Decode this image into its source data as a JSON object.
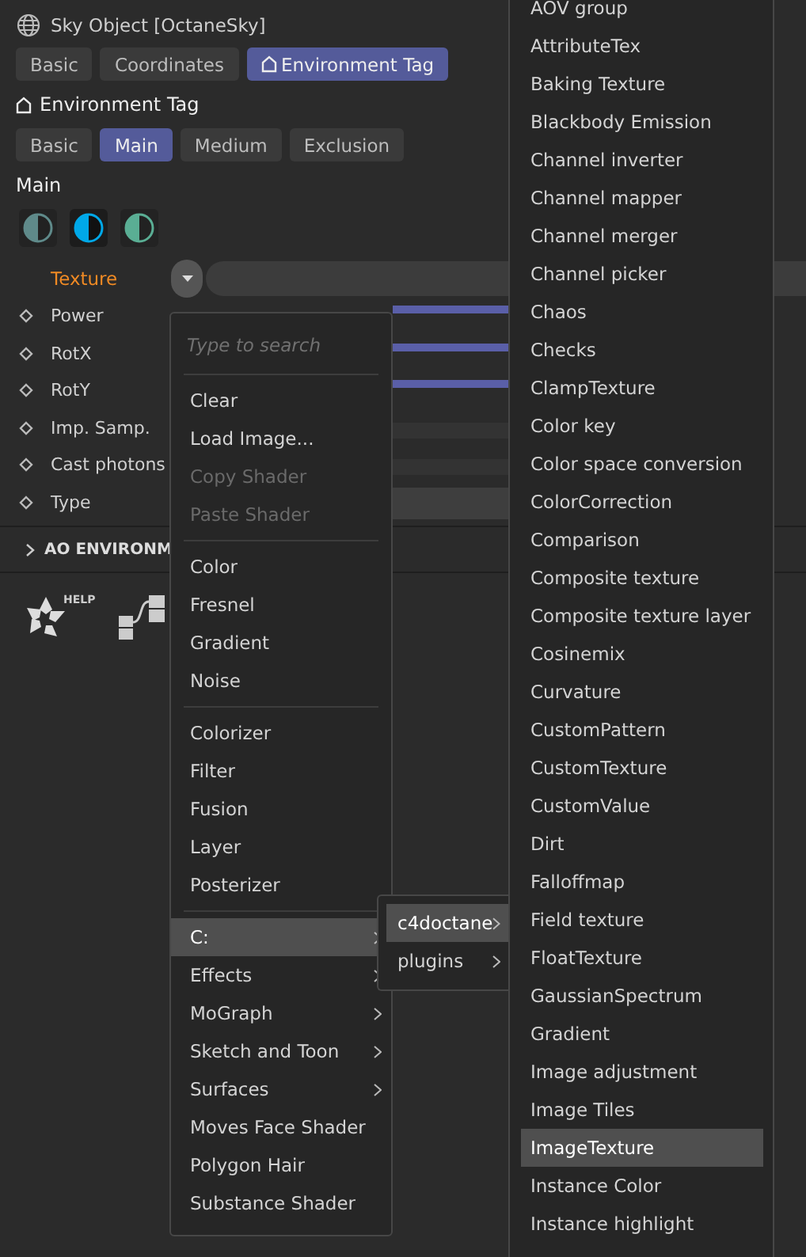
{
  "window": {
    "title": "Sky Object [OctaneSky]"
  },
  "tabs": [
    {
      "label": "Basic",
      "selected": false,
      "kind": "plain"
    },
    {
      "label": "Coordinates",
      "selected": false,
      "kind": "plain"
    },
    {
      "label": "Environment Tag",
      "selected": true,
      "kind": "tag"
    }
  ],
  "section": {
    "title": "Environment Tag"
  },
  "subtabs": [
    {
      "label": "Basic",
      "selected": false
    },
    {
      "label": "Main",
      "selected": true
    },
    {
      "label": "Medium",
      "selected": false
    },
    {
      "label": "Exclusion",
      "selected": false
    }
  ],
  "group_title": "Main",
  "presets": [
    {
      "color": "#5f8a8a",
      "selected": false
    },
    {
      "color": "#00a8e8",
      "selected": true
    },
    {
      "color": "#5aae94",
      "selected": false
    }
  ],
  "texture": {
    "label": "Texture"
  },
  "params": [
    {
      "label": "Power",
      "kind": "slider"
    },
    {
      "label": "RotX",
      "kind": "slider"
    },
    {
      "label": "RotY",
      "kind": "slider"
    },
    {
      "label": "Imp. Samp.",
      "kind": "checkbox"
    },
    {
      "label": "Cast photons",
      "kind": "checkbox"
    },
    {
      "label": "Type",
      "kind": "dropdown"
    }
  ],
  "collapsed_section": {
    "label": "AO ENVIRONM",
    "expanded": false
  },
  "help": {
    "label": "HELP"
  },
  "shader_menu": {
    "placeholder": "Type to search",
    "groups": [
      [
        {
          "label": "Clear",
          "disabled": false
        },
        {
          "label": "Load Image...",
          "disabled": false
        },
        {
          "label": "Copy Shader",
          "disabled": true
        },
        {
          "label": "Paste Shader",
          "disabled": true
        }
      ],
      [
        {
          "label": "Color",
          "disabled": false
        },
        {
          "label": "Fresnel",
          "disabled": false
        },
        {
          "label": "Gradient",
          "disabled": false
        },
        {
          "label": "Noise",
          "disabled": false
        }
      ],
      [
        {
          "label": "Colorizer",
          "disabled": false
        },
        {
          "label": "Filter",
          "disabled": false
        },
        {
          "label": "Fusion",
          "disabled": false
        },
        {
          "label": "Layer",
          "disabled": false
        },
        {
          "label": "Posterizer",
          "disabled": false
        }
      ],
      [
        {
          "label": "C:",
          "disabled": false,
          "submenu": true,
          "selected": true
        },
        {
          "label": "Effects",
          "disabled": false,
          "submenu": true,
          "selected": false
        },
        {
          "label": "MoGraph",
          "disabled": false,
          "submenu": true,
          "selected": false
        },
        {
          "label": "Sketch and Toon",
          "disabled": false,
          "submenu": true,
          "selected": false
        },
        {
          "label": "Surfaces",
          "disabled": false,
          "submenu": true,
          "selected": false
        },
        {
          "label": "Moves Face Shader",
          "disabled": false,
          "submenu": false,
          "selected": false
        },
        {
          "label": "Polygon Hair",
          "disabled": false,
          "submenu": false,
          "selected": false
        },
        {
          "label": "Substance Shader",
          "disabled": false,
          "submenu": false,
          "selected": false
        }
      ]
    ]
  },
  "path_menu": [
    {
      "label": "c4doctane",
      "selected": true
    },
    {
      "label": "plugins",
      "selected": false
    }
  ],
  "octane_menu": [
    {
      "label": "AOV group",
      "selected": false
    },
    {
      "label": "AttributeTex",
      "selected": false
    },
    {
      "label": "Baking Texture",
      "selected": false
    },
    {
      "label": "Blackbody Emission",
      "selected": false
    },
    {
      "label": "Channel inverter",
      "selected": false
    },
    {
      "label": "Channel mapper",
      "selected": false
    },
    {
      "label": "Channel merger",
      "selected": false
    },
    {
      "label": "Channel picker",
      "selected": false
    },
    {
      "label": "Chaos",
      "selected": false
    },
    {
      "label": "Checks",
      "selected": false
    },
    {
      "label": "ClampTexture",
      "selected": false
    },
    {
      "label": "Color key",
      "selected": false
    },
    {
      "label": "Color space conversion",
      "selected": false
    },
    {
      "label": "ColorCorrection",
      "selected": false
    },
    {
      "label": "Comparison",
      "selected": false
    },
    {
      "label": "Composite texture",
      "selected": false
    },
    {
      "label": "Composite texture layer",
      "selected": false
    },
    {
      "label": "Cosinemix",
      "selected": false
    },
    {
      "label": "Curvature",
      "selected": false
    },
    {
      "label": "CustomPattern",
      "selected": false
    },
    {
      "label": "CustomTexture",
      "selected": false
    },
    {
      "label": "CustomValue",
      "selected": false
    },
    {
      "label": "Dirt",
      "selected": false
    },
    {
      "label": "Falloffmap",
      "selected": false
    },
    {
      "label": "Field texture",
      "selected": false
    },
    {
      "label": "FloatTexture",
      "selected": false
    },
    {
      "label": "GaussianSpectrum",
      "selected": false
    },
    {
      "label": "Gradient",
      "selected": false
    },
    {
      "label": "Image adjustment",
      "selected": false
    },
    {
      "label": "Image Tiles",
      "selected": false
    },
    {
      "label": "ImageTexture",
      "selected": true
    },
    {
      "label": "Instance Color",
      "selected": false
    },
    {
      "label": "Instance highlight",
      "selected": false
    }
  ]
}
